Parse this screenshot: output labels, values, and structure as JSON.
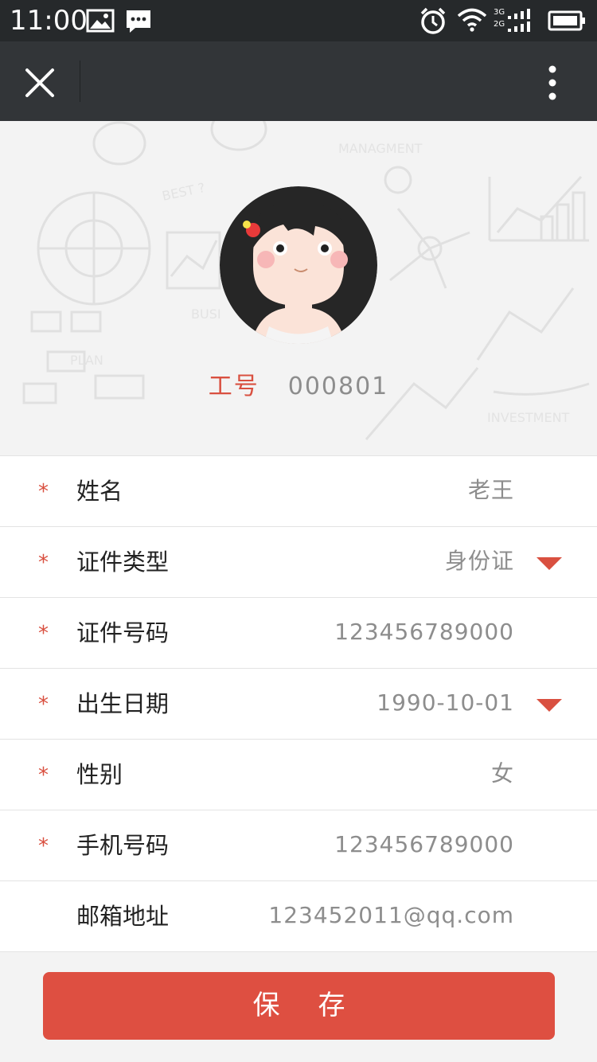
{
  "status_bar": {
    "time": "11:00",
    "icons": [
      "image-icon",
      "message-icon",
      "alarm-icon",
      "wifi-icon",
      "signal-3g-icon",
      "signal-2g-icon",
      "battery-icon"
    ],
    "network_labels": [
      "3G",
      "2G"
    ]
  },
  "nav": {
    "close_icon": "close-icon",
    "more_icon": "more-vertical-icon"
  },
  "profile": {
    "employee_no_label": "工号",
    "employee_no": "000801"
  },
  "form": {
    "rows": [
      {
        "required": "*",
        "label": "姓名",
        "value": "老王",
        "dropdown": false
      },
      {
        "required": "*",
        "label": "证件类型",
        "value": "身份证",
        "dropdown": true
      },
      {
        "required": "*",
        "label": "证件号码",
        "value": "123456789000",
        "dropdown": false
      },
      {
        "required": "*",
        "label": "出生日期",
        "value": "1990-10-01",
        "dropdown": true
      },
      {
        "required": "*",
        "label": "性别",
        "value": "女",
        "dropdown": false
      },
      {
        "required": "*",
        "label": "手机号码",
        "value": "123456789000",
        "dropdown": false
      },
      {
        "required": "",
        "label": "邮箱地址",
        "value": "123452011@qq.com",
        "dropdown": false
      }
    ]
  },
  "save_label": "保存",
  "colors": {
    "accent": "#de4f41",
    "status_bar": "#26292b",
    "nav_bar": "#323538",
    "value_text": "#8d8d8d"
  }
}
